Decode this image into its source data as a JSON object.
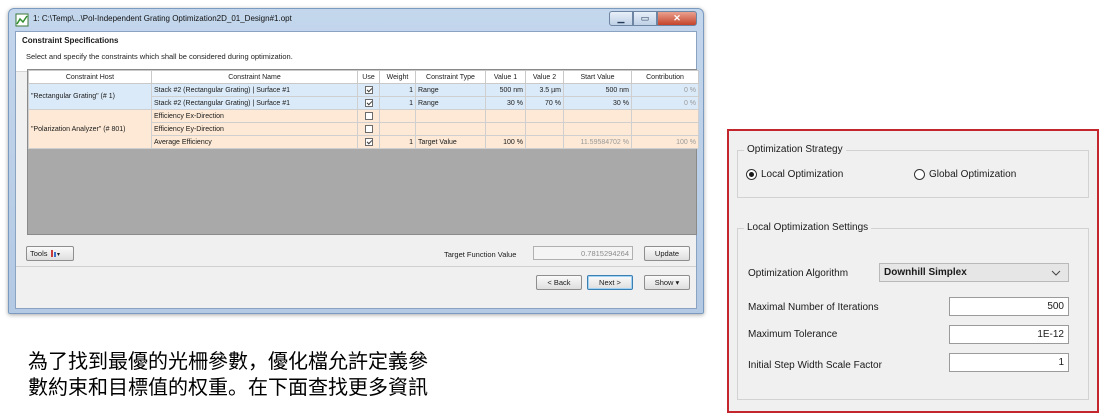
{
  "window": {
    "title": "1: C:\\Temp\\...\\Pol-Independent Grating Optimization2D_01_Design#1.opt",
    "header_title": "Constraint Specifications",
    "header_subtitle": "Select and specify the constraints which shall be considered during optimization."
  },
  "table": {
    "columns": [
      "Constraint Host",
      "Constraint Name",
      "Use",
      "Weight",
      "Constraint Type",
      "Value 1",
      "Value 2",
      "Start Value",
      "Contribution"
    ],
    "hosts": [
      "\"Rectangular Grating\" (# 1)",
      "\"Polarization Analyzer\" (# 801)"
    ],
    "rows": [
      {
        "name": "Stack #2 (Rectangular Grating) | Surface #1",
        "use": true,
        "weight": "1",
        "type": "Range",
        "value1": "500 nm",
        "value2": "3.5 µm",
        "start": "500 nm",
        "contribution": "0 %"
      },
      {
        "name": "Stack #2 (Rectangular Grating) | Surface #1",
        "use": true,
        "weight": "1",
        "type": "Range",
        "value1": "30 %",
        "value2": "70 %",
        "start": "30 %",
        "contribution": "0 %"
      },
      {
        "name": "Efficiency Ex-Direction",
        "use": false,
        "weight": "",
        "type": "",
        "value1": "",
        "value2": "",
        "start": "",
        "contribution": ""
      },
      {
        "name": "Efficiency Ey-Direction",
        "use": false,
        "weight": "",
        "type": "",
        "value1": "",
        "value2": "",
        "start": "",
        "contribution": ""
      },
      {
        "name": "Average Efficiency",
        "use": true,
        "weight": "1",
        "type": "Target Value",
        "value1": "100 %",
        "value2": "",
        "start": "11.59584702 %",
        "contribution": "100 %"
      }
    ]
  },
  "bottom": {
    "tools_label": "Tools",
    "target_function_label": "Target Function Value",
    "target_function_value": "0.7815294264",
    "update_label": "Update",
    "back_label": "< Back",
    "next_label": "Next >",
    "show_label": "Show ▾"
  },
  "caption": {
    "line1": "為了找到最優的光柵參數，優化檔允許定義參",
    "line2": "數約束和目標值的权重。在下面查找更多資訊"
  },
  "settings": {
    "strategy_title": "Optimization Strategy",
    "local_label": "Local Optimization",
    "global_label": "Global Optimization",
    "selected": "local",
    "local_settings_title": "Local Optimization Settings",
    "algorithm_label": "Optimization Algorithm",
    "algorithm_value": "Downhill Simplex",
    "max_iter_label": "Maximal Number of Iterations",
    "max_iter_value": "500",
    "max_tol_label": "Maximum Tolerance",
    "max_tol_value": "1E-12",
    "step_label": "Initial Step Width Scale Factor",
    "step_value": "1"
  },
  "colors": {
    "row_blue": "#dbeaf8",
    "row_orange": "#fde9d5",
    "highlight_border": "#c4262e"
  }
}
